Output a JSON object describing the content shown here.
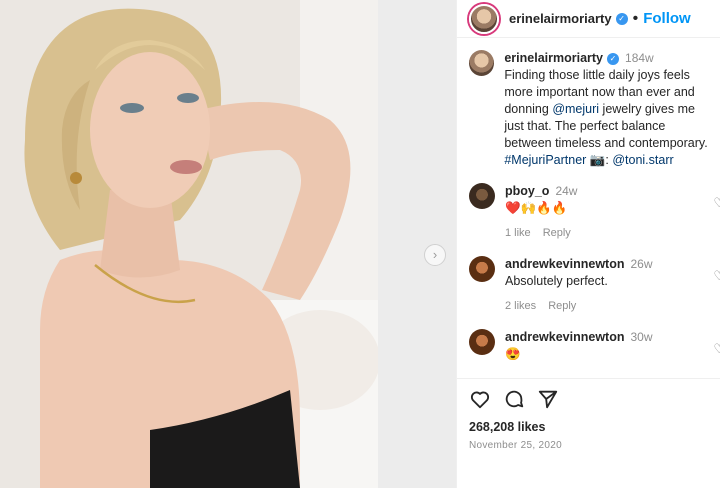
{
  "post": {
    "username": "erinelairmoriarty",
    "follow_label": "Follow",
    "caption_age": "184w",
    "caption_text": "Finding those little daily joys feels more important now than ever and donning",
    "caption_mention1": "@mejuri",
    "caption_text2": "jewelry gives me just that. The perfect balance between timeless and contemporary.",
    "caption_hashtag": "#MejuriPartner",
    "caption_tail": "📷:",
    "caption_mention2": "@toni.starr",
    "likes": "268,208 likes",
    "date": "November 25, 2020"
  },
  "comments": [
    {
      "user": "pboy_o",
      "age": "24w",
      "text": "❤️🙌🔥🔥",
      "likes": "1 like",
      "reply": "Reply"
    },
    {
      "user": "andrewkevinnewton",
      "age": "26w",
      "text": "Absolutely perfect.",
      "likes": "2 likes",
      "reply": "Reply"
    },
    {
      "user": "andrewkevinnewton",
      "age": "30w",
      "text": "😍",
      "likes": "",
      "reply": ""
    }
  ],
  "colors": {
    "follow": "#0095f6",
    "link": "#00376b",
    "verified": "#3897f0"
  }
}
